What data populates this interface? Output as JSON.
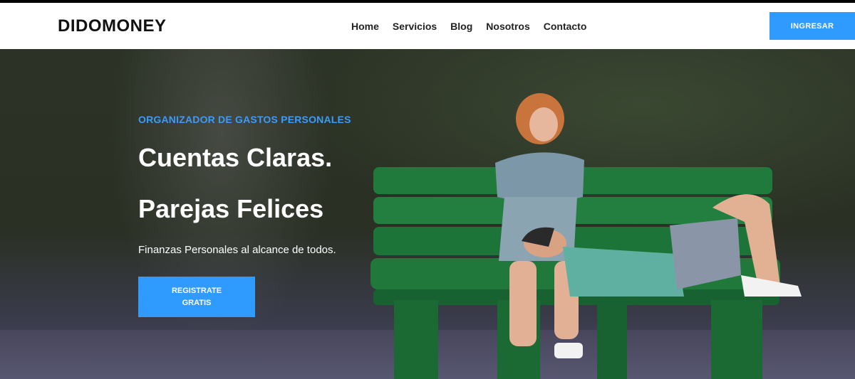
{
  "header": {
    "logo": "DIDOMONEY",
    "nav": [
      "Home",
      "Servicios",
      "Blog",
      "Nosotros",
      "Contacto"
    ],
    "login_label": "INGRESAR"
  },
  "hero": {
    "eyebrow": "ORGANIZADOR DE GASTOS PERSONALES",
    "headline_line1": "Cuentas Claras.",
    "headline_line2": "Parejas Felices",
    "subtext": "Finanzas Personales al alcance de todos.",
    "cta_line1": "REGISTRATE",
    "cta_line2": "GRATIS",
    "image": "couple-on-green-bench"
  },
  "colors": {
    "accent": "#2f9bff",
    "bench": "#1f7a3c"
  }
}
